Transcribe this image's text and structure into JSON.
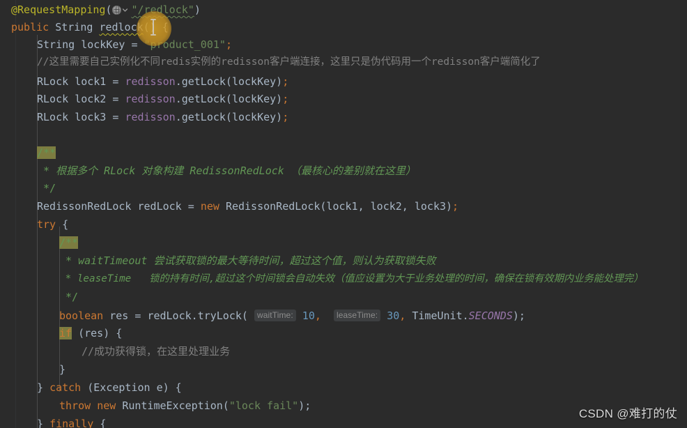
{
  "editor": {
    "app": "IntelliJ IDEA code editor",
    "language": "Java",
    "theme": "Darcula",
    "background_color": "#2b2b2b",
    "default_text_color": "#a9b7c6",
    "colors": {
      "keyword": "#cc7832",
      "annotation": "#bbb529",
      "string": "#6a8759",
      "number": "#6897bb",
      "field": "#9876aa",
      "line_comment": "#808080",
      "javadoc": "#629755",
      "brace_match_highlight": "#7c7c40",
      "param_hint_background": "#3d3f41",
      "param_hint_text": "#8c8c8c",
      "indent_guide": "#4b4b4b",
      "click_highlight": "#d6a026"
    },
    "gutter_icon": {
      "name": "globe-icon",
      "tooltip_chevron": "chevron-down-icon"
    }
  },
  "lines": [
    {
      "n": 1,
      "indent": 0,
      "text": "@RequestMapping(\"/redlock\")"
    },
    {
      "n": 2,
      "indent": 0,
      "text": "public String redlock() {"
    },
    {
      "n": 3,
      "indent": 1,
      "text": "String lockKey = \"product_001\";"
    },
    {
      "n": 4,
      "indent": 1,
      "text": "//这里需要自己实例化不同redis实例的redisson客户端连接，这里只是伪代码用一个redisson客户端简化了"
    },
    {
      "n": 5,
      "indent": 1,
      "text": "RLock lock1 = redisson.getLock(lockKey);"
    },
    {
      "n": 6,
      "indent": 1,
      "text": "RLock lock2 = redisson.getLock(lockKey);"
    },
    {
      "n": 7,
      "indent": 1,
      "text": "RLock lock3 = redisson.getLock(lockKey);"
    },
    {
      "n": 8,
      "indent": 1,
      "text": ""
    },
    {
      "n": 9,
      "indent": 1,
      "text": "/**"
    },
    {
      "n": 10,
      "indent": 1,
      "text": " * 根据多个 RLock 对象构建 RedissonRedLock （最核心的差别就在这里）"
    },
    {
      "n": 11,
      "indent": 1,
      "text": " */"
    },
    {
      "n": 12,
      "indent": 1,
      "text": "RedissonRedLock redLock = new RedissonRedLock(lock1, lock2, lock3);"
    },
    {
      "n": 13,
      "indent": 1,
      "text": "try {"
    },
    {
      "n": 14,
      "indent": 2,
      "text": "/**"
    },
    {
      "n": 15,
      "indent": 2,
      "text": " * waitTimeout 尝试获取锁的最大等待时间，超过这个值，则认为获取锁失败"
    },
    {
      "n": 16,
      "indent": 2,
      "text": " * leaseTime   锁的持有时间,超过这个时间锁会自动失效（值应设置为大于业务处理的时间，确保在锁有效期内业务能处理完）"
    },
    {
      "n": 17,
      "indent": 2,
      "text": " */"
    },
    {
      "n": 18,
      "indent": 2,
      "text": "boolean res = redLock.tryLock( waitTime: 10,  leaseTime: 30, TimeUnit.SECONDS);"
    },
    {
      "n": 19,
      "indent": 2,
      "text": "if (res) {"
    },
    {
      "n": 20,
      "indent": 3,
      "text": "//成功获得锁，在这里处理业务"
    },
    {
      "n": 21,
      "indent": 2,
      "text": "}"
    },
    {
      "n": 22,
      "indent": 1,
      "text": "} catch (Exception e) {"
    },
    {
      "n": 23,
      "indent": 2,
      "text": "throw new RuntimeException(\"lock fail\");"
    },
    {
      "n": 24,
      "indent": 1,
      "text": "} finally {"
    }
  ],
  "tokens": {
    "l1_annotation": "@RequestMapping",
    "l1_paren_open": "(",
    "l1_string": "\"/redlock\"",
    "l1_paren_close": ")",
    "l2_public": "public",
    "l2_type": "String",
    "l2_method": "redlock",
    "l2_parens": "()",
    "l2_brace": "{",
    "l3_type": "String",
    "l3_var": "lockKey",
    "l3_eq": "=",
    "l3_string": "\"product_001\"",
    "l3_semi": ";",
    "l4_comment": "//这里需要自己实例化不同redis实例的redisson客户端连接，这里只是伪代码用一个redisson客户端简化了",
    "l5_type": "RLock",
    "l5_var": "lock1",
    "l5_recv": "redisson",
    "l5_call": ".getLock(lockKey)",
    "l6_var": "lock2",
    "l7_var": "lock3",
    "doc_open": "/**",
    "doc_close": " */",
    "l10_doc": " * 根据多个 RLock 对象构建 RedissonRedLock （最核心的差别就在这里）",
    "l12_type": "RedissonRedLock",
    "l12_var": "redLock",
    "l12_new": "new",
    "l12_ctor": "RedissonRedLock(lock1, lock2, lock3)",
    "l13_try": "try",
    "l15_doc": " * waitTimeout 尝试获取锁的最大等待时间，超过这个值，则认为获取锁失败",
    "l16_doc": " * leaseTime   锁的持有时间,超过这个时间锁会自动失效（值应设置为大于业务处理的时间，确保在锁有效期内业务能处理完）",
    "l18_boolean": "boolean",
    "l18_var": "res",
    "l18_call": "redLock.tryLock(",
    "l18_hint_wait": "waitTime:",
    "l18_wait_value": "10",
    "l18_hint_lease": "leaseTime:",
    "l18_lease_value": "30",
    "l18_timeunit": "TimeUnit.",
    "l18_seconds": "SECONDS",
    "l18_tail": ");",
    "l19_if": "if",
    "l19_cond": " (res) {",
    "l20_comment": "//成功获得锁，在这里处理业务",
    "l21_brace": "}",
    "l22_catch": "catch",
    "l22_sig": " (Exception e) {",
    "l23_throw": "throw",
    "l23_new": "new",
    "l23_ctor": "RuntimeException(",
    "l23_string": "\"lock fail\"",
    "l23_tail": ");",
    "l24_finally": "finally"
  },
  "watermark": {
    "text": "CSDN @难打的仗"
  }
}
